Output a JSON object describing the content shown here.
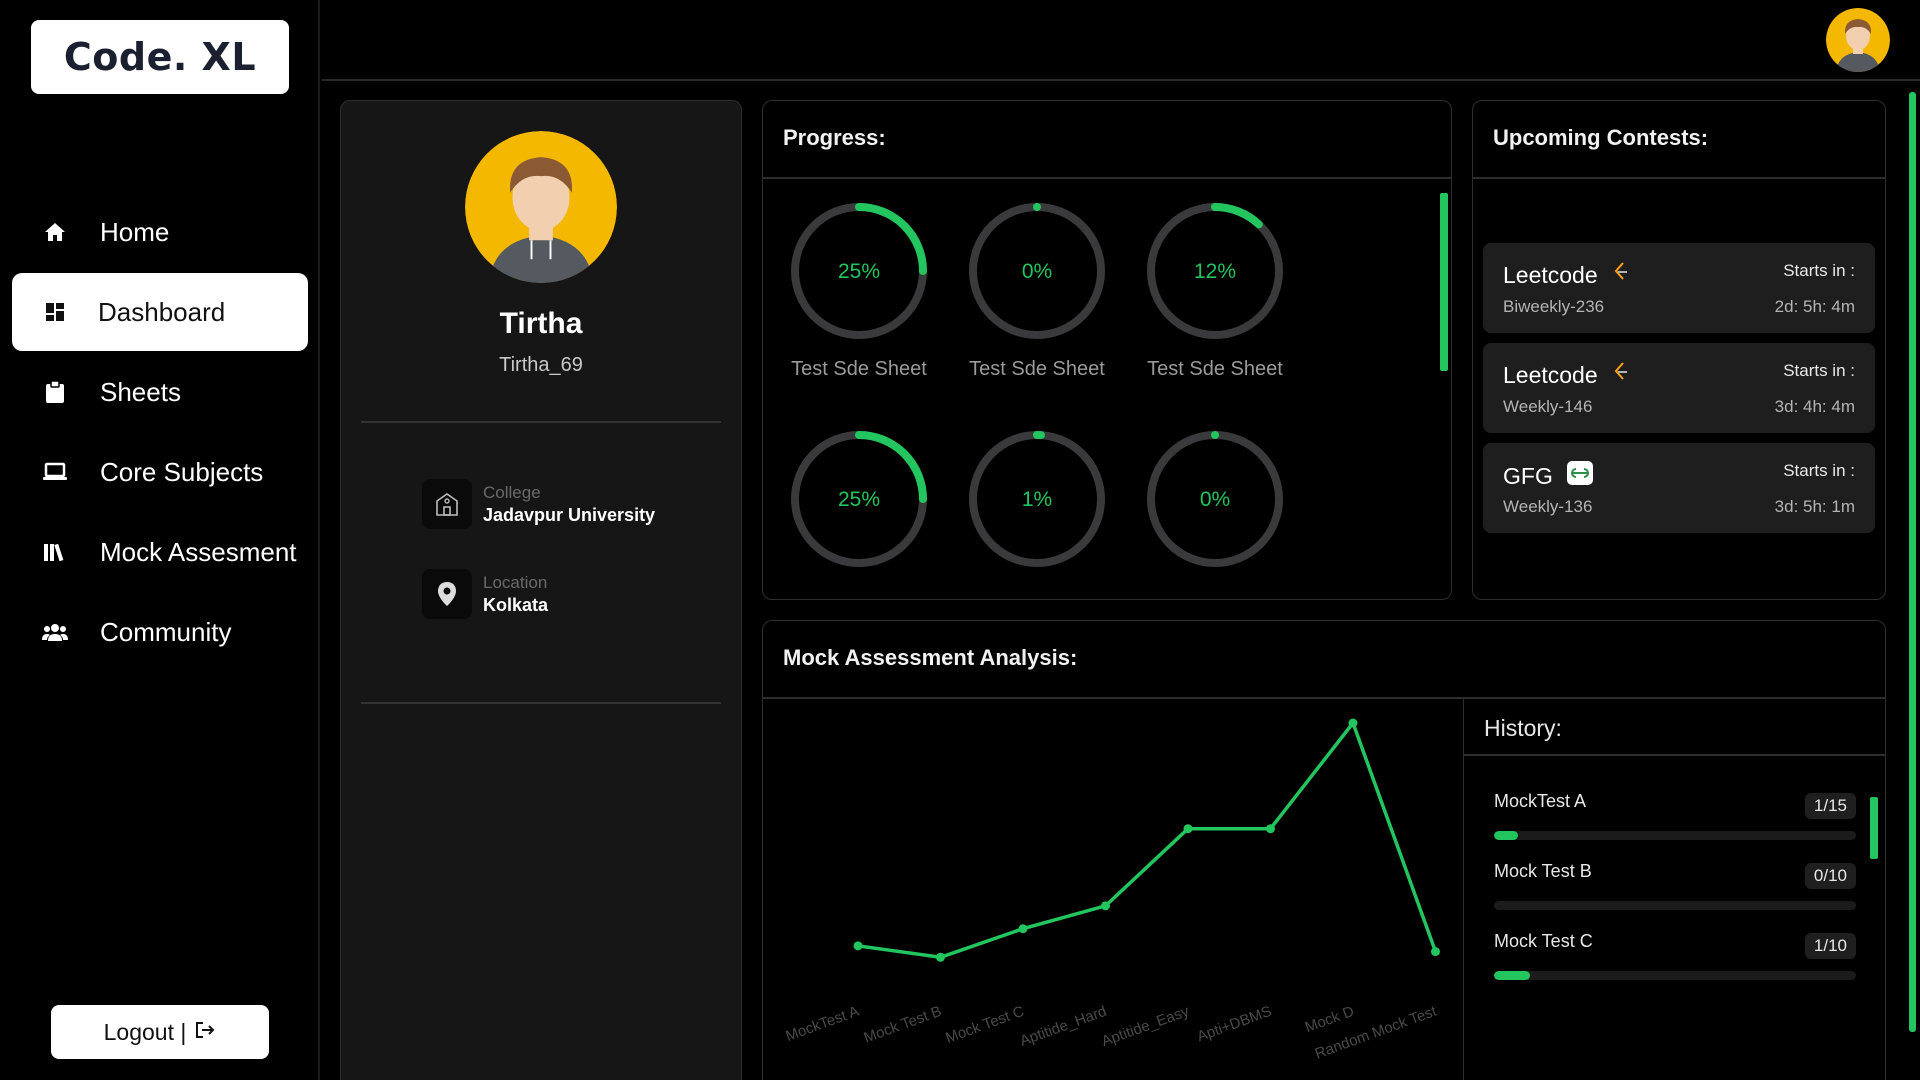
{
  "app": {
    "logo": "Code. XL"
  },
  "nav": {
    "items": [
      {
        "label": "Home",
        "icon": "home-icon",
        "active": false
      },
      {
        "label": "Dashboard",
        "icon": "dashboard-icon",
        "active": true
      },
      {
        "label": "Sheets",
        "icon": "clipboard-icon",
        "active": false
      },
      {
        "label": "Core Subjects",
        "icon": "laptop-icon",
        "active": false
      },
      {
        "label": "Mock Assesment",
        "icon": "books-icon",
        "active": false
      },
      {
        "label": "Community",
        "icon": "users-icon",
        "active": false
      }
    ],
    "logout_label": "Logout |"
  },
  "profile": {
    "name": "Tirtha",
    "username": "Tirtha_69",
    "college_label": "College",
    "college": "Jadavpur University",
    "location_label": "Location",
    "location": "Kolkata"
  },
  "progress": {
    "title": "Progress:",
    "rings": [
      {
        "percent": 25,
        "label_text": "25%",
        "name": "Test Sde Sheet"
      },
      {
        "percent": 0,
        "label_text": "0%",
        "name": "Test Sde Sheet"
      },
      {
        "percent": 12,
        "label_text": "12%",
        "name": "Test Sde Sheet"
      },
      {
        "percent": 25,
        "label_text": "25%",
        "name": ""
      },
      {
        "percent": 1,
        "label_text": "1%",
        "name": ""
      },
      {
        "percent": 0,
        "label_text": "0%",
        "name": ""
      }
    ]
  },
  "contests": {
    "title": "Upcoming Contests:",
    "items": [
      {
        "platform": "Leetcode",
        "icon": "leetcode-icon",
        "event": "Biweekly-236",
        "starts_label": "Starts in :",
        "starts_in": "2d: 5h: 4m"
      },
      {
        "platform": "Leetcode",
        "icon": "leetcode-icon",
        "event": "Weekly-146",
        "starts_label": "Starts in :",
        "starts_in": "3d: 4h: 4m"
      },
      {
        "platform": "GFG",
        "icon": "gfg-icon",
        "event": "Weekly-136",
        "starts_label": "Starts in :",
        "starts_in": "3d: 5h: 1m"
      }
    ]
  },
  "mock": {
    "title": "Mock Assessment Analysis:",
    "history_title": "History:",
    "history": [
      {
        "name": "MockTest A",
        "score": "1/15",
        "fraction": 0.0667
      },
      {
        "name": "Mock Test B",
        "score": "0/10",
        "fraction": 0
      },
      {
        "name": "Mock Test C",
        "score": "1/10",
        "fraction": 0.1
      }
    ]
  },
  "chart_data": {
    "type": "line",
    "categories": [
      "MockTest A",
      "Mock Test B",
      "Mock Test C",
      "Aptitide_Hard",
      "Aptitide_Easy",
      "Apti+DBMS",
      "Mock D",
      "Random Mock Test"
    ],
    "values": [
      1.0,
      0.8,
      1.3,
      1.7,
      3.05,
      3.05,
      4.9,
      0.9
    ],
    "color": "#22c55e",
    "grid": false,
    "title": "",
    "xlabel": "",
    "ylabel": ""
  },
  "colors": {
    "accent": "#22c55e",
    "track": "#3a3a3c",
    "panel": "#161616"
  }
}
